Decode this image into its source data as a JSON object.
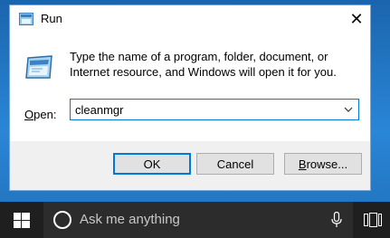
{
  "dialog": {
    "title": "Run",
    "close_glyph": "✕",
    "description": "Type the name of a program, folder, document, or Internet resource, and Windows will open it for you.",
    "open_label_underlined": "O",
    "open_label_rest": "pen:",
    "input_value": "cleanmgr",
    "buttons": {
      "ok": "OK",
      "cancel": "Cancel",
      "browse_underlined": "B",
      "browse_rest": "rowse..."
    },
    "icons": {
      "title": "run-icon",
      "big": "run-icon",
      "dropdown": "chevron-down-icon",
      "close": "close-icon"
    }
  },
  "taskbar": {
    "search_placeholder": "Ask me anything",
    "icons": [
      "windows-logo-icon",
      "cortana-circle-icon",
      "microphone-icon",
      "task-view-icon"
    ]
  },
  "colors": {
    "accent": "#0078d7",
    "taskbar": "#1f1f1f",
    "search_box": "#2c2c2c",
    "desktop": "#1f6fb8"
  }
}
